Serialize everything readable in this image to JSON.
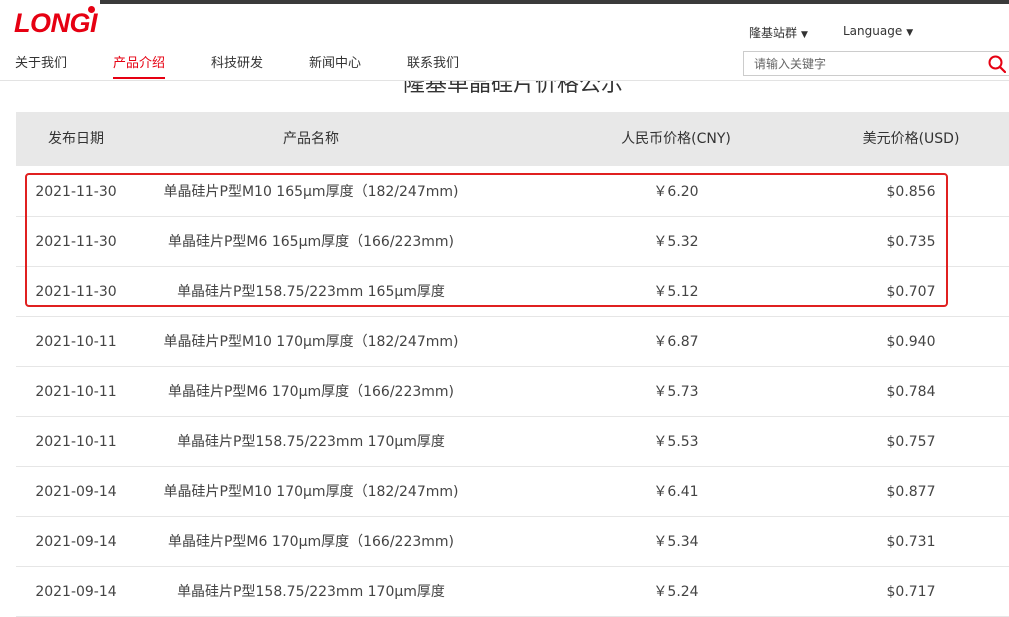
{
  "header": {
    "logo_text": "LONGI",
    "nav": [
      {
        "label": "关于我们",
        "active": false
      },
      {
        "label": "产品介绍",
        "active": true
      },
      {
        "label": "科技研发",
        "active": false
      },
      {
        "label": "新闻中心",
        "active": false
      },
      {
        "label": "联系我们",
        "active": false
      }
    ],
    "site_group_label": "隆基站群",
    "language_label": "Language",
    "search_placeholder": "请输入关键字",
    "accent_color": "#e60012"
  },
  "page": {
    "heading": "隆基单晶硅片价格公示"
  },
  "table": {
    "headers": [
      "发布日期",
      "产品名称",
      "人民币价格(CNY)",
      "美元价格(USD)"
    ],
    "rows": [
      {
        "date": "2021-11-30",
        "name": "单晶硅片P型M10 165μm厚度（182/247mm)",
        "cny": "￥6.20",
        "usd": "$0.856"
      },
      {
        "date": "2021-11-30",
        "name": "单晶硅片P型M6 165μm厚度（166/223mm)",
        "cny": "￥5.32",
        "usd": "$0.735"
      },
      {
        "date": "2021-11-30",
        "name": "单晶硅片P型158.75/223mm 165μm厚度",
        "cny": "￥5.12",
        "usd": "$0.707"
      },
      {
        "date": "2021-10-11",
        "name": "单晶硅片P型M10 170μm厚度（182/247mm)",
        "cny": "￥6.87",
        "usd": "$0.940"
      },
      {
        "date": "2021-10-11",
        "name": "单晶硅片P型M6 170μm厚度（166/223mm)",
        "cny": "￥5.73",
        "usd": "$0.784"
      },
      {
        "date": "2021-10-11",
        "name": "单晶硅片P型158.75/223mm 170μm厚度",
        "cny": "￥5.53",
        "usd": "$0.757"
      },
      {
        "date": "2021-09-14",
        "name": "单晶硅片P型M10 170μm厚度（182/247mm)",
        "cny": "￥6.41",
        "usd": "$0.877"
      },
      {
        "date": "2021-09-14",
        "name": "单晶硅片P型M6 170μm厚度（166/223mm)",
        "cny": "￥5.34",
        "usd": "$0.731"
      },
      {
        "date": "2021-09-14",
        "name": "单晶硅片P型158.75/223mm 170μm厚度",
        "cny": "￥5.24",
        "usd": "$0.717"
      }
    ]
  }
}
